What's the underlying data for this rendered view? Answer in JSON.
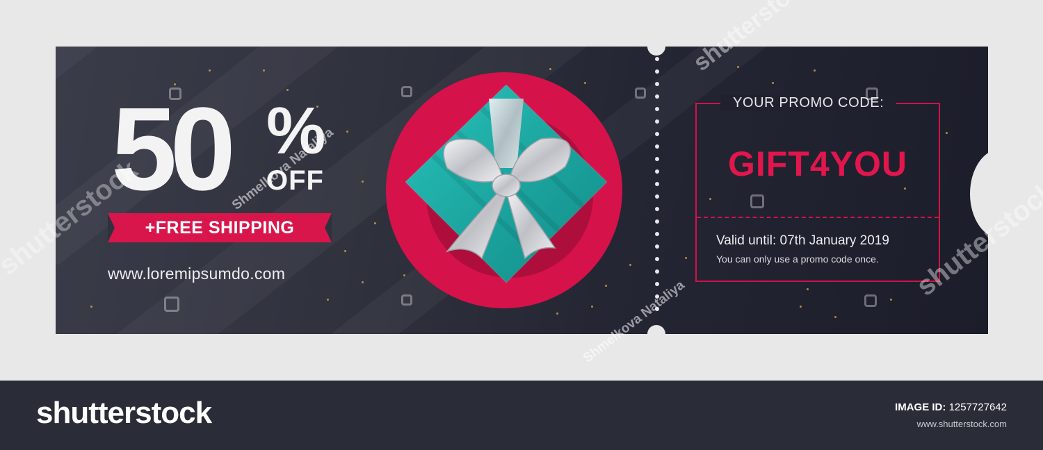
{
  "coupon": {
    "discount_number": "50",
    "discount_percent": "%",
    "discount_off": "OFF",
    "shipping_label": "+FREE SHIPPING",
    "website": "www.loremipsumdo.com"
  },
  "promo": {
    "label": "YOUR PROMO CODE:",
    "code": "GIFT4YOU",
    "valid_until": "Valid until: 07th January 2019",
    "note": "You can only use a promo code once."
  },
  "watermark": {
    "author": "Shmelkova Nataliya",
    "brand": "shutterstock"
  },
  "footer": {
    "brand": "shutterstock",
    "image_id_label": "IMAGE ID:",
    "image_id_value": "1257727642",
    "site": "www.shutterstock.com"
  },
  "colors": {
    "accent": "#d9164c",
    "ticket_dark": "#242634",
    "gift_teal": "#1ea9a3",
    "background": "#e8e8e9",
    "footer": "#2a2d37"
  }
}
